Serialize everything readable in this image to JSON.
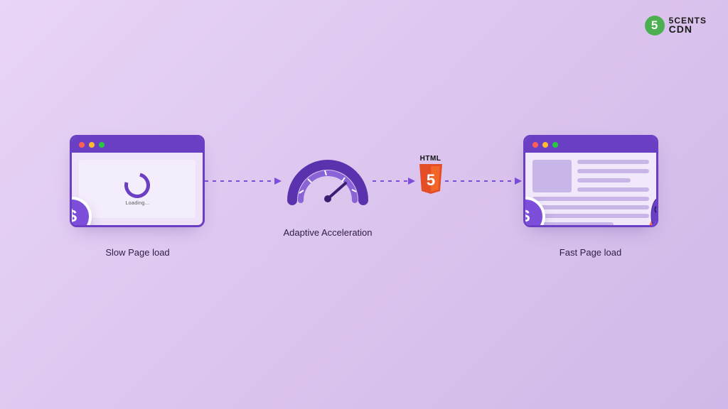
{
  "brand": {
    "badge": "5",
    "line1": "5CENTS",
    "line2": "CDN"
  },
  "flow": {
    "slow": {
      "loading": "Loading...",
      "caption": "Slow Page load",
      "currency": "$"
    },
    "accel": {
      "caption": "Adaptive Acceleration"
    },
    "html5": {
      "label": "HTML",
      "digit": "5"
    },
    "fast": {
      "caption": "Fast Page load",
      "currency": "$"
    }
  },
  "colors": {
    "brandPurple": "#6b3fc4",
    "accentOrange": "#e44d26",
    "accentGreen": "#4caf50"
  }
}
